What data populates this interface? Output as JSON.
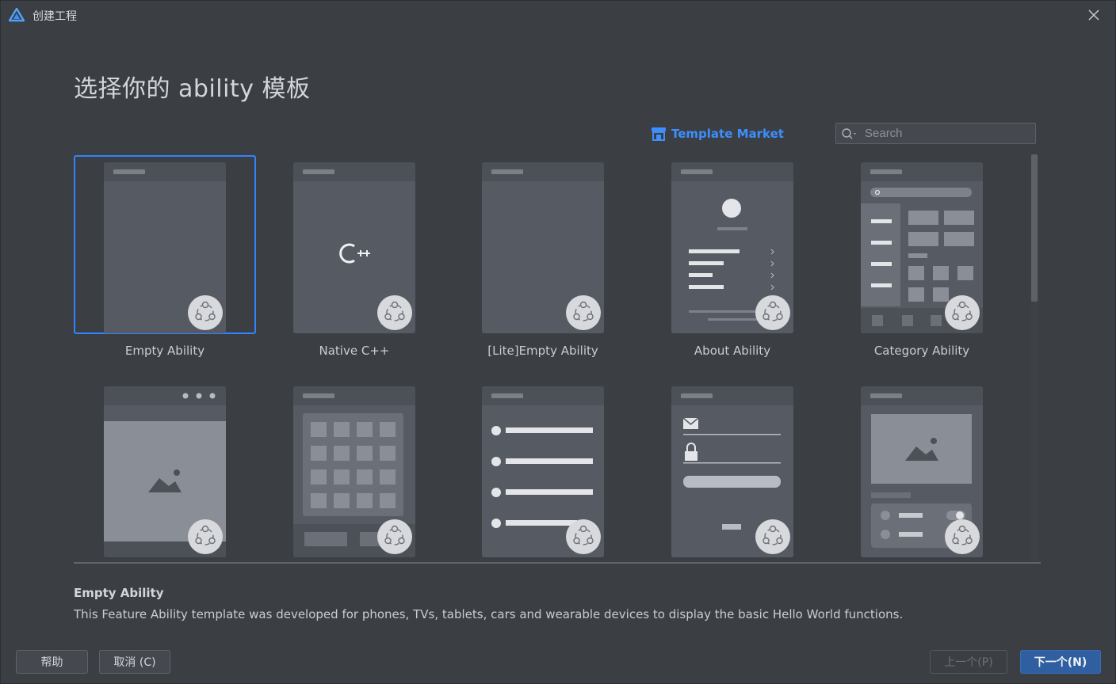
{
  "window": {
    "title": "创建工程"
  },
  "heading": "选择你的 ability 模板",
  "market": {
    "label": "Template Market"
  },
  "search": {
    "placeholder": "Search",
    "value": ""
  },
  "templates": [
    {
      "label": "Empty Ability",
      "selected": true
    },
    {
      "label": "Native C++"
    },
    {
      "label": "[Lite]Empty Ability"
    },
    {
      "label": "About Ability"
    },
    {
      "label": "Category Ability"
    },
    {
      "label": ""
    },
    {
      "label": ""
    },
    {
      "label": ""
    },
    {
      "label": ""
    },
    {
      "label": ""
    }
  ],
  "description": {
    "title": "Empty Ability",
    "text": "This Feature Ability template was developed for phones, TVs, tablets, cars and wearable devices to display the basic Hello World functions."
  },
  "buttons": {
    "help": "帮助",
    "cancel": "取消 (C)",
    "previous": "上一个(P)",
    "next": "下一个(N)"
  },
  "colors": {
    "accent": "#2f85ff",
    "link": "#3d8eff",
    "primary_button": "#2f5fa0",
    "background": "#3b3f44"
  }
}
